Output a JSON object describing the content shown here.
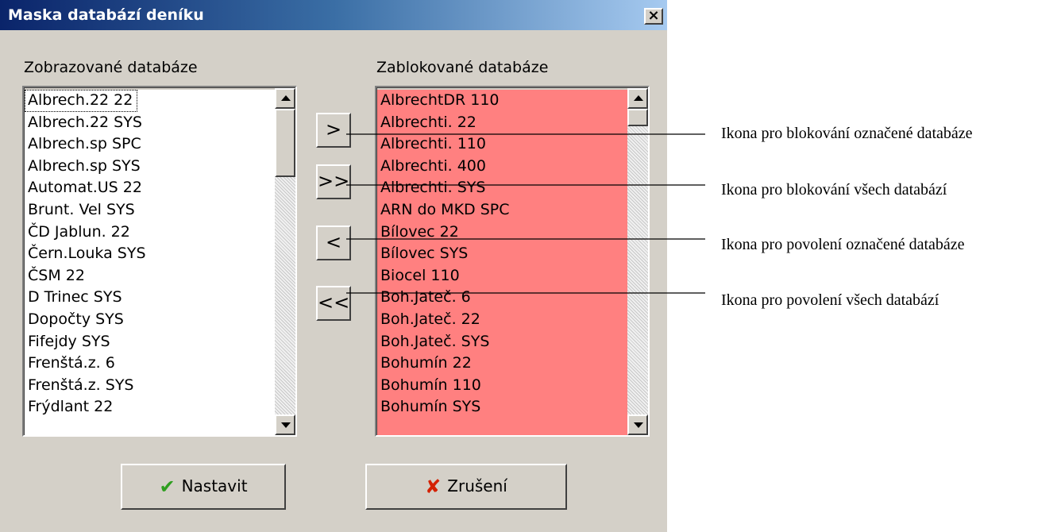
{
  "dialog": {
    "title": "Maska databází deníku",
    "close_glyph": "×"
  },
  "left_list": {
    "label": "Zobrazované databáze",
    "items": [
      "Albrech.22  22",
      "Albrech.22 SYS",
      "Albrech.sp SPC",
      "Albrech.sp SYS",
      "Automat.US  22",
      "Brunt. Vel SYS",
      "ČD Jablun.  22",
      "Čern.Louka SYS",
      "ČSM        22",
      "D Trinec   SYS",
      "Dopočty    SYS",
      "Fifejdy    SYS",
      "Frenštá.z.   6",
      "Frenštá.z. SYS",
      "Frýdlant    22"
    ],
    "selected_index": 0
  },
  "right_list": {
    "label": "Zablokované databáze",
    "items": [
      "AlbrechtDR 110",
      "Albrechti.  22",
      "Albrechti. 110",
      "Albrechti. 400",
      "Albrechti. SYS",
      "ARN do MKD SPC",
      "Bílovec     22",
      "Bílovec    SYS",
      "Biocel     110",
      "Boh.Jateč.   6",
      "Boh.Jateč.  22",
      "Boh.Jateč. SYS",
      "Bohumín     22",
      "Bohumín    110",
      "Bohumín    SYS"
    ],
    "background_color": "#ff8080"
  },
  "transfer_buttons": {
    "block_selected": ">",
    "block_all": ">>",
    "allow_selected": "<",
    "allow_all": "<<"
  },
  "buttons": {
    "ok_label": "Nastavit",
    "ok_icon": "check-icon",
    "ok_glyph": "✔",
    "cancel_label": "Zrušení",
    "cancel_icon": "cross-icon",
    "cancel_glyph": "✘"
  },
  "annotations": {
    "block_selected": "Ikona pro blokování označené databáze",
    "block_all": "Ikona pro blokování všech databází",
    "allow_selected": "Ikona pro povolení označené databáze",
    "allow_all": "Ikona pro povolení všech databází"
  },
  "colors": {
    "check": "#2e9e1f",
    "cross": "#d42000"
  }
}
